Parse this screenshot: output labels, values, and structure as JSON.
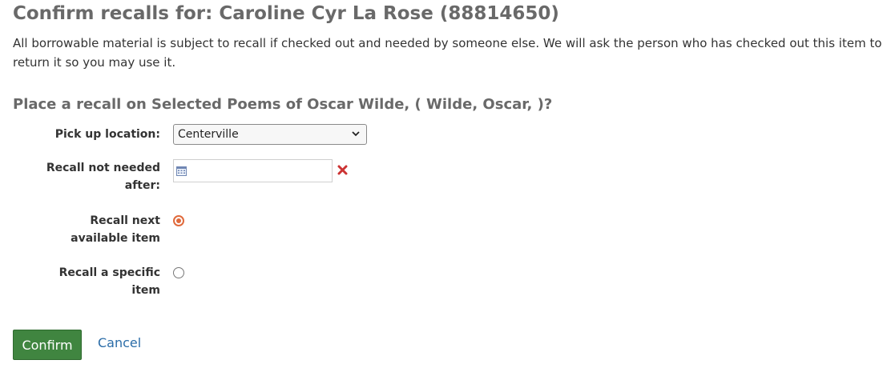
{
  "page": {
    "title": "Confirm recalls for: Caroline Cyr La Rose (88814650)",
    "intro": "All borrowable material is subject to recall if checked out and needed by someone else. We will ask the person who has checked out this item to return it so you may use it."
  },
  "form": {
    "heading": "Place a recall on Selected Poems of Oscar Wilde, ( Wilde, Oscar, )?",
    "pickup_label": "Pick up location:",
    "pickup_value": "Centerville",
    "expiration_label": "Recall not needed after:",
    "expiration_value": "",
    "next_item_label": "Recall next available item",
    "specific_item_label": "Recall a specific item",
    "selected_option": "next_item"
  },
  "actions": {
    "confirm_label": "Confirm",
    "cancel_label": "Cancel"
  },
  "colors": {
    "title": "#696969",
    "confirm_bg": "#408540",
    "radio_accent": "#e06a3c",
    "clear_icon": "#cc3333",
    "link": "#2b6da8"
  },
  "icons": {
    "calendar": "calendar-icon",
    "clear": "clear-x-icon",
    "dropdown": "chevron-down-icon"
  }
}
